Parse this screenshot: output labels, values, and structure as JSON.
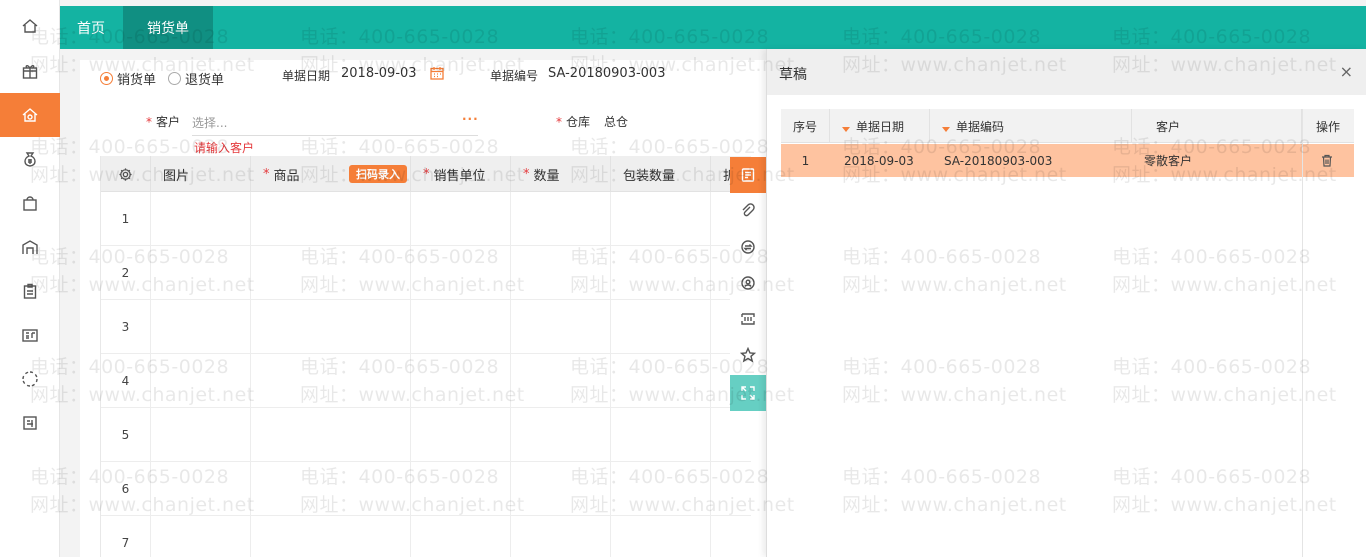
{
  "topbar": {
    "tabs": [
      {
        "label": "首页"
      },
      {
        "label": "销货单"
      }
    ]
  },
  "sidebar": {
    "items": [
      {
        "icon": "home-icon"
      },
      {
        "icon": "gift-icon"
      },
      {
        "icon": "sales-icon",
        "active": true
      },
      {
        "icon": "money-bag-icon"
      },
      {
        "icon": "shopping-bag-icon"
      },
      {
        "icon": "warehouse-icon"
      },
      {
        "icon": "clipboard-icon"
      },
      {
        "icon": "report-icon"
      },
      {
        "icon": "loading-icon"
      },
      {
        "icon": "new-icon"
      }
    ]
  },
  "form": {
    "type_options": [
      "销货单",
      "退货单"
    ],
    "selected_type": "销货单",
    "date_label": "单据日期",
    "date_value": "2018-09-03",
    "code_label": "单据编号",
    "code_value": "SA-20180903-003",
    "customer_label": "客户",
    "customer_placeholder": "选择...",
    "customer_more": "···",
    "customer_error": "请输入客户",
    "warehouse_label": "仓库",
    "warehouse_value": "总仓"
  },
  "grid": {
    "columns": [
      "图片",
      "商品",
      "销售单位",
      "数量",
      "包装数量",
      "折"
    ],
    "required": [
      false,
      true,
      true,
      true,
      false,
      false
    ],
    "scan_button": "扫码录入",
    "row_numbers": [
      "1",
      "2",
      "3",
      "4",
      "5",
      "6",
      "7"
    ]
  },
  "tools": [
    {
      "icon": "draft-icon"
    },
    {
      "icon": "attachment-icon"
    },
    {
      "icon": "exchange-icon"
    },
    {
      "icon": "customer-icon"
    },
    {
      "icon": "barcode-icon"
    },
    {
      "icon": "star-icon"
    },
    {
      "icon": "expand-icon"
    }
  ],
  "draft_panel": {
    "title": "草稿",
    "close": "×",
    "columns": [
      "序号",
      "单据日期",
      "单据编码",
      "客户",
      "操作"
    ],
    "rows": [
      {
        "index": "1",
        "date": "2018-09-03",
        "code": "SA-20180903-003",
        "customer": "零散客户"
      }
    ]
  },
  "watermark": {
    "phone": "电话：400-665-0028",
    "site": "网址：www.chanjet.net"
  },
  "colors": {
    "teal": "#14b3a2",
    "teal_dark": "#108f82",
    "orange": "#f57e38",
    "highlight_row": "#fec3a0"
  }
}
